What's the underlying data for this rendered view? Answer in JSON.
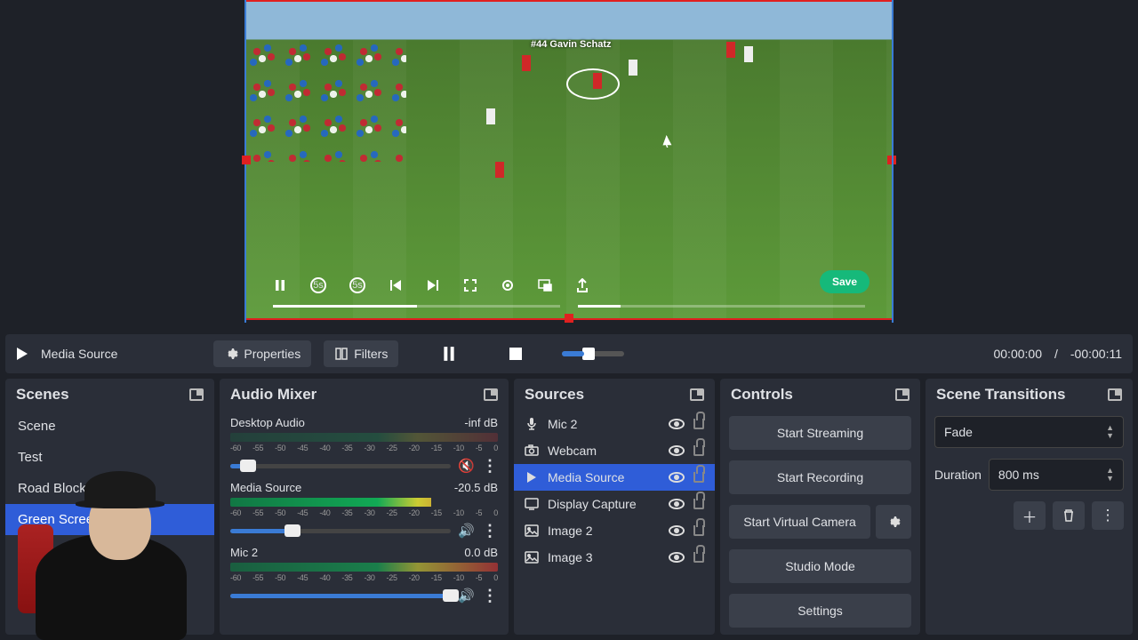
{
  "preview": {
    "player_tag": "#44 Gavin Schatz",
    "save": "Save"
  },
  "toolbar": {
    "source_label": "Media Source",
    "properties": "Properties",
    "filters": "Filters",
    "time_current": "00:00:00",
    "time_sep": "/",
    "time_total": "-00:00:11"
  },
  "panels": {
    "scenes": "Scenes",
    "mixer": "Audio Mixer",
    "sources": "Sources",
    "controls": "Controls",
    "transitions": "Scene Transitions"
  },
  "scenes": [
    {
      "name": "Scene",
      "active": false
    },
    {
      "name": "Test",
      "active": false
    },
    {
      "name": "Road Blocks",
      "active": false
    },
    {
      "name": "Green Screen",
      "active": true
    }
  ],
  "mixer_ticks": "-60 -55 -50 -45 -40 -35 -30 -25 -20 -15 -10 -5 0",
  "mixer": [
    {
      "name": "Desktop Audio",
      "db": "-inf dB",
      "muted": true,
      "fill": 8
    },
    {
      "name": "Media Source",
      "db": "-20.5 dB",
      "muted": false,
      "fill": 28
    },
    {
      "name": "Mic 2",
      "db": "0.0 dB",
      "muted": false,
      "fill": 100
    }
  ],
  "sources": [
    {
      "icon": "mic",
      "name": "Mic 2",
      "active": false
    },
    {
      "icon": "camera",
      "name": "Webcam",
      "active": false
    },
    {
      "icon": "play",
      "name": "Media Source",
      "active": true
    },
    {
      "icon": "display",
      "name": "Display Capture",
      "active": false
    },
    {
      "icon": "image",
      "name": "Image 2",
      "active": false
    },
    {
      "icon": "image",
      "name": "Image 3",
      "active": false
    }
  ],
  "controls": {
    "stream": "Start Streaming",
    "record": "Start Recording",
    "vcam": "Start Virtual Camera",
    "studio": "Studio Mode",
    "settings": "Settings"
  },
  "transitions": {
    "type": "Fade",
    "duration_label": "Duration",
    "duration_value": "800 ms"
  }
}
